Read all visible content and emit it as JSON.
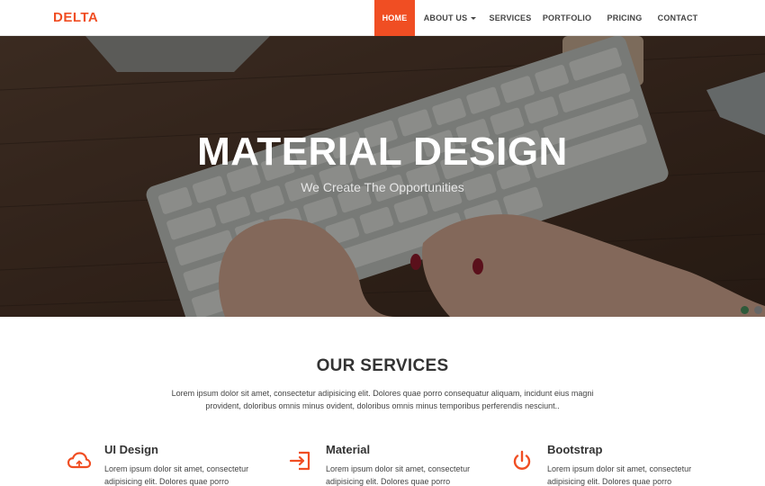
{
  "brand": "DELTA",
  "nav": {
    "items": [
      {
        "label": "HOME"
      },
      {
        "label": "ABOUT US"
      },
      {
        "label": "SERVICES"
      },
      {
        "label": "PORTFOLIO"
      },
      {
        "label": "PRICING"
      },
      {
        "label": "CONTACT"
      }
    ]
  },
  "hero": {
    "title": "MATERIAL DESIGN",
    "subtitle": "We Create The Opportunities"
  },
  "services": {
    "title": "OUR SERVICES",
    "description": "Lorem ipsum dolor sit amet, consectetur adipisicing elit. Dolores quae porro consequatur aliquam, incidunt eius magni provident, doloribus omnis minus ovident, doloribus omnis minus temporibus perferendis nesciunt..",
    "items": [
      {
        "title": "UI Design",
        "text": "Lorem ipsum dolor sit amet, consectetur adipisicing elit. Dolores quae porro",
        "icon": "cloud-icon"
      },
      {
        "title": "Material",
        "text": "Lorem ipsum dolor sit amet, consectetur adipisicing elit. Dolores quae porro",
        "icon": "sign-in-icon"
      },
      {
        "title": "Bootstrap",
        "text": "Lorem ipsum dolor sit amet, consectetur adipisicing elit. Dolores quae porro",
        "icon": "power-icon"
      }
    ]
  },
  "colors": {
    "accent": "#f04e23",
    "text": "#333333"
  }
}
